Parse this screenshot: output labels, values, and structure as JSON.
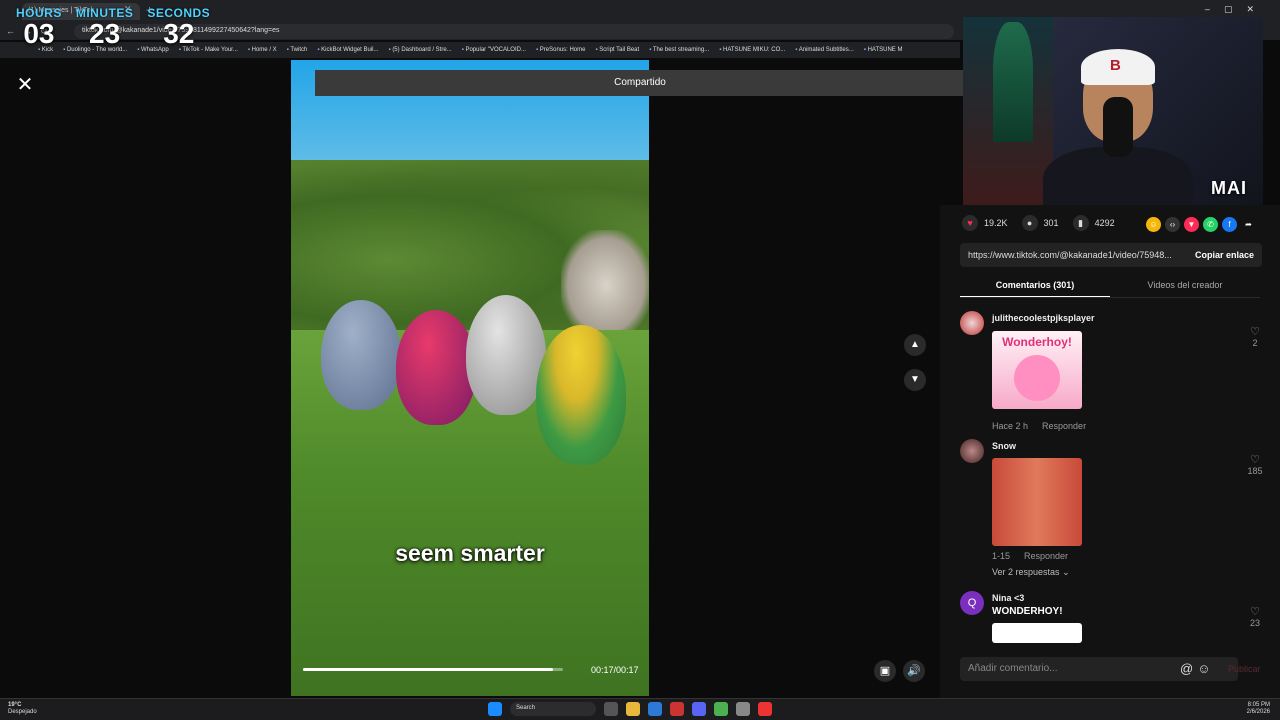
{
  "timer": {
    "hours_label": "HOURS",
    "hours": "03",
    "minutes_label": "MINUTES",
    "minutes": "23",
    "seconds_label": "SECONDS",
    "seconds": "32"
  },
  "browser": {
    "tab_title": "(1) Mensajes | TikTok",
    "address": "tiktok.com/@kakanade1/video/7594811499227450642?lang=es",
    "bookmarks": [
      "Kick",
      "Duolingo - The world...",
      "WhatsApp",
      "TikTok - Make Your...",
      "Home / X",
      "Twitch",
      "KickBot Widget Buil...",
      "(5) Dashboard / Stre...",
      "Popular \"VOCALOID...",
      "PreSonus: Home",
      "Script Tail Beat",
      "The best streaming...",
      "HATSUNE MIKU: CO...",
      "Animated Subtitles...",
      "HATSUNE M"
    ]
  },
  "page": {
    "shared_banner": "Compartido",
    "video_caption": "seem smarter",
    "video_time": "00:17/00:17",
    "video_progress_fraction": 0.96
  },
  "webcam": {
    "badge": "MAI",
    "cap_logo": "B"
  },
  "sidebar": {
    "likes": "19.2K",
    "comments": "301",
    "saves": "4292",
    "link": "https://www.tiktok.com/@kakanade1/video/75948...",
    "copy_label": "Copiar enlace",
    "tab_comments": "Comentarios (301)",
    "tab_creator": "Videos del creador",
    "comments_list": [
      {
        "user": "julithecoolestpjksplayer",
        "sticker_text": "Wonderhoy!",
        "time": "Hace 2 h",
        "reply": "Responder",
        "likes": "2"
      },
      {
        "user": "Snow",
        "time": "1-15",
        "reply": "Responder",
        "likes": "185",
        "more_replies": "Ver 2 respuestas"
      },
      {
        "user": "Nina <3",
        "avatar_letter": "Q",
        "text": "WONDERHOY!",
        "likes": "23"
      }
    ],
    "input_placeholder": "Añadir comentario...",
    "post_label": "Publicar"
  },
  "taskbar": {
    "weather_temp": "19°C",
    "weather_desc": "Despejado",
    "search_label": "Search",
    "time": "8:05 PM",
    "date": "2/6/2026"
  },
  "colors": {
    "like_pink": "#fe2c55",
    "timer_label": "#4fd1ff"
  }
}
